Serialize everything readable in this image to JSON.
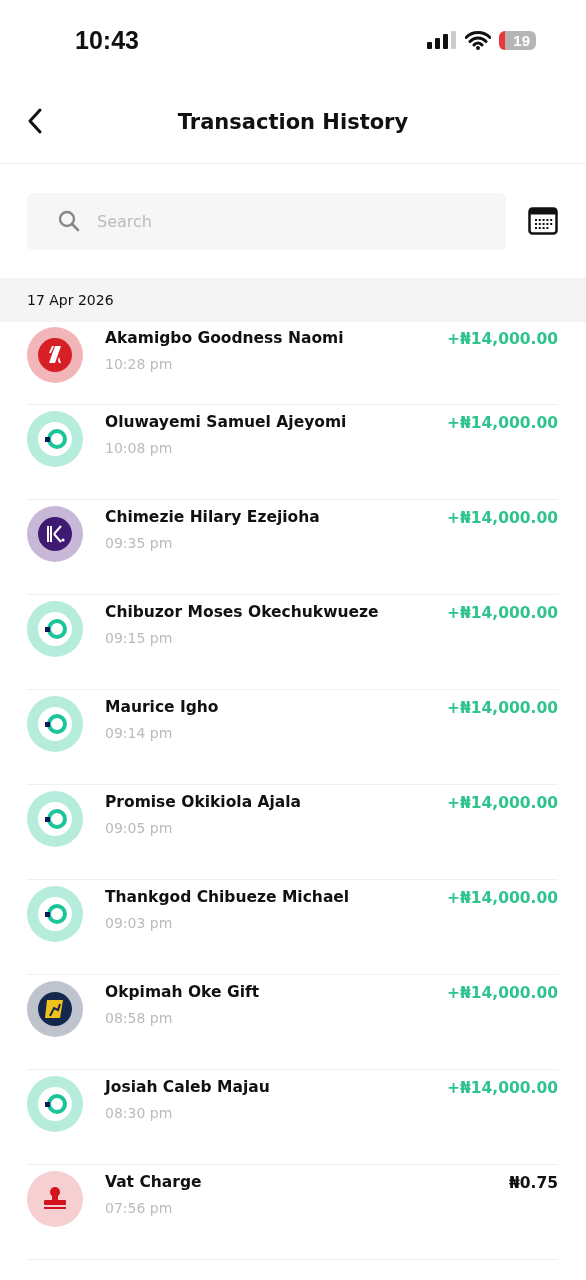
{
  "status_bar": {
    "time": "10:43",
    "battery": "19"
  },
  "header": {
    "title": "Transaction History"
  },
  "search": {
    "placeholder": "Search"
  },
  "date_group": "17 Apr 2026",
  "transactions": [
    {
      "kind": "bolt",
      "name": "Akamigbo Goodness Naomi",
      "time": "10:28 pm",
      "amount": "+₦14,000.00",
      "credit": true
    },
    {
      "kind": "ring",
      "name": "Oluwayemi Samuel Ajeyomi",
      "time": "10:08 pm",
      "amount": "+₦14,000.00",
      "credit": true
    },
    {
      "kind": "stripes",
      "name": "Chimezie Hilary Ezejioha",
      "time": "09:35 pm",
      "amount": "+₦14,000.00",
      "credit": true
    },
    {
      "kind": "ring",
      "name": "Chibuzor Moses Okechukwueze",
      "time": "09:15 pm",
      "amount": "+₦14,000.00",
      "credit": true
    },
    {
      "kind": "ring",
      "name": "Maurice Igho",
      "time": "09:14 pm",
      "amount": "+₦14,000.00",
      "credit": true
    },
    {
      "kind": "ring",
      "name": "Promise Okikiola Ajala",
      "time": "09:05 pm",
      "amount": "+₦14,000.00",
      "credit": true
    },
    {
      "kind": "ring",
      "name": "Thankgod Chibueze Michael",
      "time": "09:03 pm",
      "amount": "+₦14,000.00",
      "credit": true
    },
    {
      "kind": "badge",
      "name": "Okpimah Oke Gift",
      "time": "08:58 pm",
      "amount": "+₦14,000.00",
      "credit": true
    },
    {
      "kind": "ring",
      "name": "Josiah Caleb Majau",
      "time": "08:30 pm",
      "amount": "+₦14,000.00",
      "credit": true
    },
    {
      "kind": "stamp",
      "name": "Vat Charge",
      "time": "07:56 pm",
      "amount": "₦0.75",
      "credit": false
    }
  ]
}
